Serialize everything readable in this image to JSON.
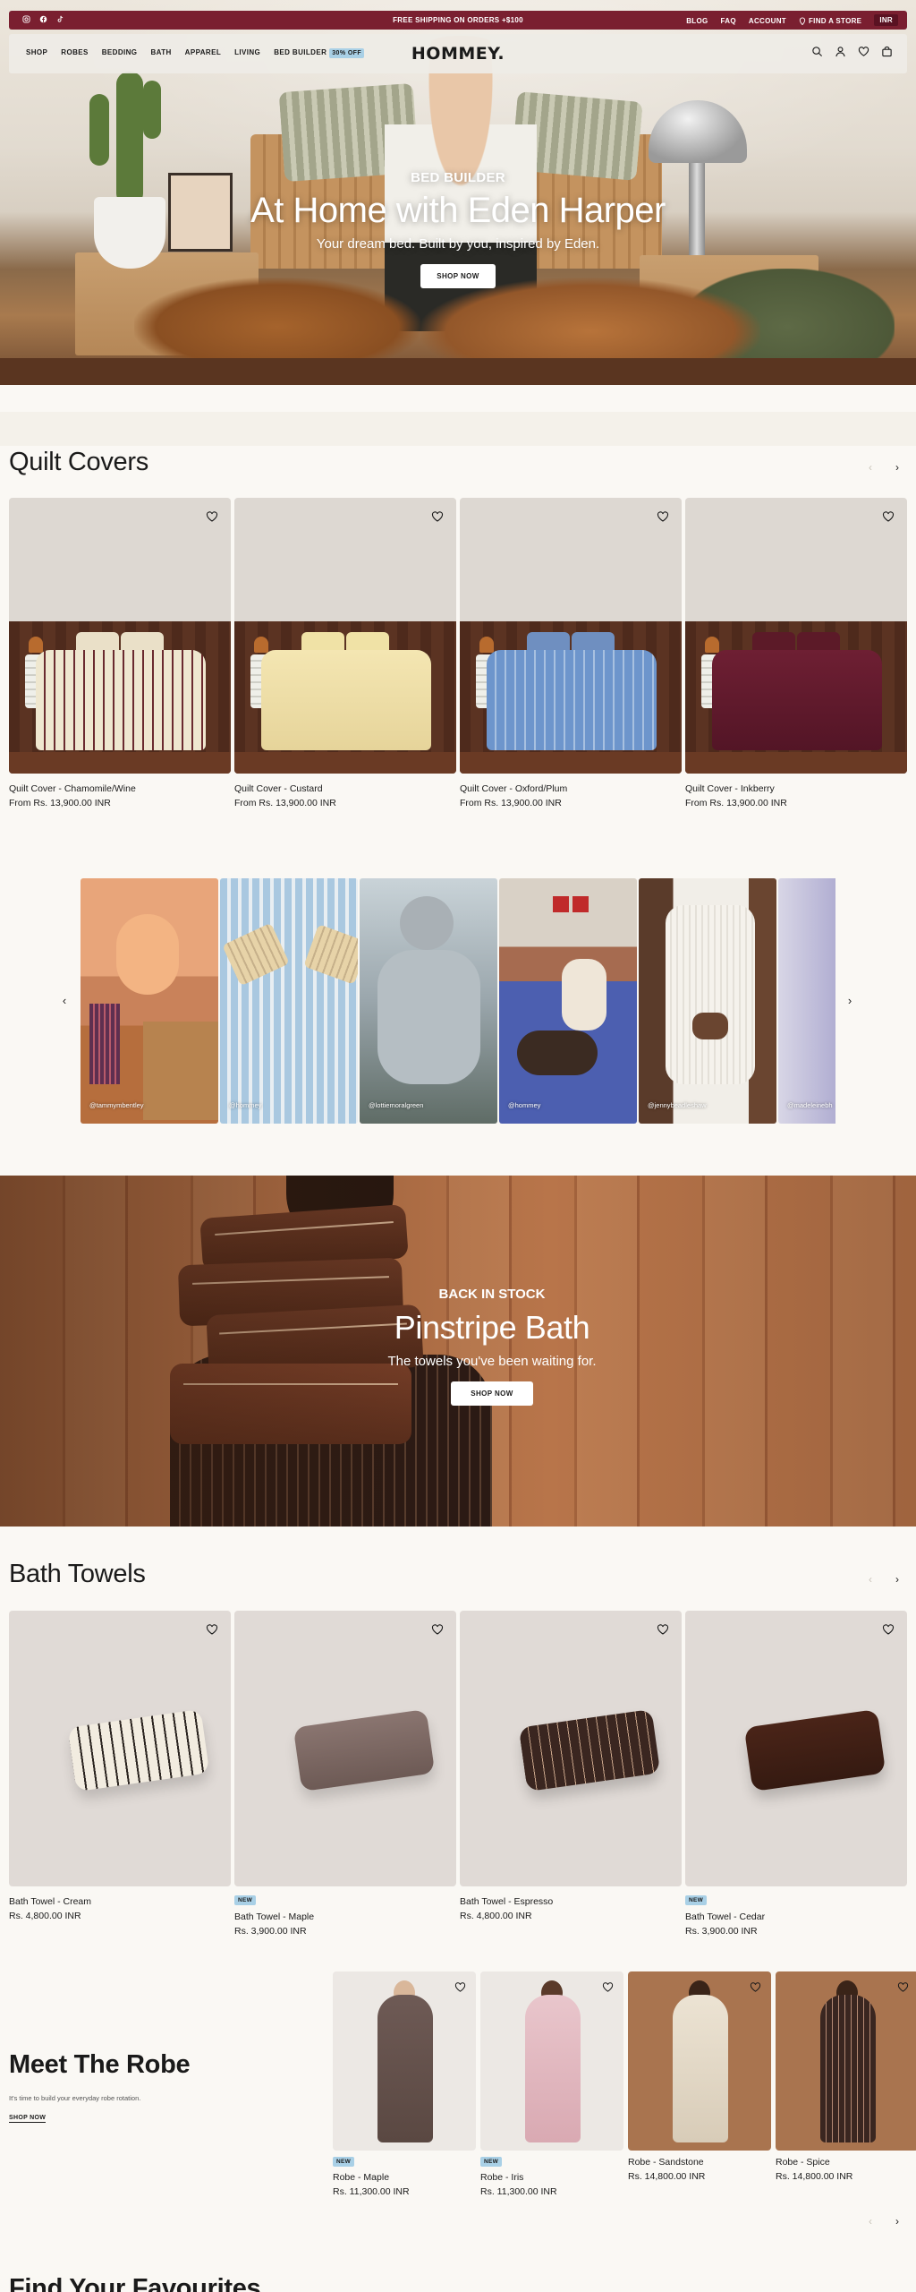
{
  "announcement": {
    "message": "FREE SHIPPING ON ORDERS +$100",
    "links": [
      "BLOG",
      "FAQ",
      "ACCOUNT",
      "FIND A STORE"
    ],
    "currency": "INR",
    "socials": [
      "instagram-icon",
      "facebook-icon",
      "tiktok-icon"
    ]
  },
  "nav": {
    "logo": "HOMMEY.",
    "links": [
      "SHOP",
      "ROBES",
      "BEDDING",
      "BATH",
      "APPAREL",
      "LIVING",
      "BED BUILDER"
    ],
    "badge": "30% OFF",
    "icons": [
      "search-icon",
      "account-icon",
      "wishlist-icon",
      "bag-icon"
    ]
  },
  "hero": {
    "eyebrow": "BED BUILDER",
    "title": "At Home with Eden Harper",
    "subtitle": "Your dream bed. Built by you, inspired by Eden.",
    "cta": "SHOP NOW"
  },
  "quilts": {
    "title": "Quilt Covers",
    "products": [
      {
        "name": "Quilt Cover - Chamomile/Wine",
        "price": "From  Rs. 13,900.00 INR"
      },
      {
        "name": "Quilt Cover - Custard",
        "price": "From  Rs. 13,900.00 INR"
      },
      {
        "name": "Quilt Cover - Oxford/Plum",
        "price": "From  Rs. 13,900.00 INR"
      },
      {
        "name": "Quilt Cover - Inkberry",
        "price": "From  Rs. 13,900.00 INR"
      }
    ]
  },
  "ugc": {
    "handles": [
      "@tammymbentley",
      "@hommey",
      "@lottiemoralgreen",
      "@hommey",
      "@jennybeadleshaw",
      "@madeleinebh"
    ]
  },
  "pinstripe": {
    "eyebrow": "BACK IN STOCK",
    "title": "Pinstripe Bath",
    "subtitle": "The towels you've been waiting for.",
    "cta": "SHOP NOW"
  },
  "towels": {
    "title": "Bath Towels",
    "products": [
      {
        "name": "Bath Towel - Cream",
        "price": "Rs. 4,800.00 INR",
        "badge": ""
      },
      {
        "name": "Bath Towel - Maple",
        "price": "Rs. 3,900.00 INR",
        "badge": "NEW"
      },
      {
        "name": "Bath Towel - Espresso",
        "price": "Rs. 4,800.00 INR",
        "badge": ""
      },
      {
        "name": "Bath Towel - Cedar",
        "price": "Rs. 3,900.00 INR",
        "badge": "NEW"
      }
    ]
  },
  "robes": {
    "title": "Meet The Robe",
    "subtitle": "It's time to build your everyday robe rotation.",
    "cta": "SHOP NOW",
    "products": [
      {
        "name": "Robe - Maple",
        "price": "Rs. 11,300.00 INR",
        "badge": "NEW"
      },
      {
        "name": "Robe - Iris",
        "price": "Rs. 11,300.00 INR",
        "badge": "NEW"
      },
      {
        "name": "Robe - Sandstone",
        "price": "Rs. 14,800.00 INR",
        "badge": ""
      },
      {
        "name": "Robe - Spice",
        "price": "Rs. 14,800.00 INR",
        "badge": ""
      }
    ]
  },
  "favourites": {
    "title": "Find Your Favourites"
  },
  "colors": {
    "brand_burgundy": "#7a1f30",
    "badge_blue": "#a9d0e6",
    "page_bg": "#faf8f4"
  }
}
